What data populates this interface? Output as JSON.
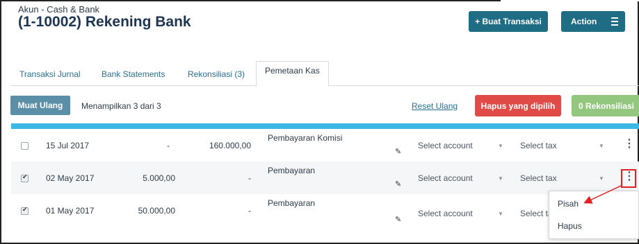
{
  "header": {
    "account_type": "Akun - Cash & Bank",
    "account_title": "(1-10002) Rekening Bank",
    "new_transaction_label": "+ Buat Transaksi",
    "action_label": "Action"
  },
  "tabs": [
    {
      "label": "Transaksi Jurnal"
    },
    {
      "label": "Bank Statements"
    },
    {
      "label": "Rekonsiliasi (3)"
    },
    {
      "label": "Pemetaan Kas",
      "active": true
    }
  ],
  "toolbar": {
    "reload_label": "Muat Ulang",
    "count_text": "Menampilkan 3 dari 3",
    "reset_label": "Reset Ulang",
    "delete_selected_label": "Hapus yang dipilih",
    "reconcile_label": "0 Rekonsiliasi"
  },
  "rows": [
    {
      "checked": false,
      "date": "15 Jul 2017",
      "debit": "-",
      "credit": "160.000,00",
      "description": "Pembayaran Komisi",
      "account": "Select account",
      "tax": "Select tax"
    },
    {
      "checked": true,
      "date": "02 May 2017",
      "debit": "5.000,00",
      "credit": "-",
      "description": "Pembayaran",
      "account": "Select account",
      "tax": "Select tax"
    },
    {
      "checked": true,
      "date": "01 May 2017",
      "debit": "50.000,00",
      "credit": "-",
      "description": "Pembayaran",
      "account": "Select account",
      "tax": "Select ta"
    }
  ],
  "row_menu": {
    "items": [
      {
        "label": "Pisah"
      },
      {
        "label": "Hapus"
      }
    ]
  },
  "icons": {
    "row_edit": "pencil-icon",
    "row_menu": "kebab-icon",
    "select_caret": "caret-down-icon",
    "action_menu": "hamburger-icon"
  },
  "colors": {
    "primary": "#1f6d84",
    "danger": "#e14b47",
    "success": "#93c77f",
    "header_bar": "#3db7e4",
    "highlight": "#e02020"
  }
}
